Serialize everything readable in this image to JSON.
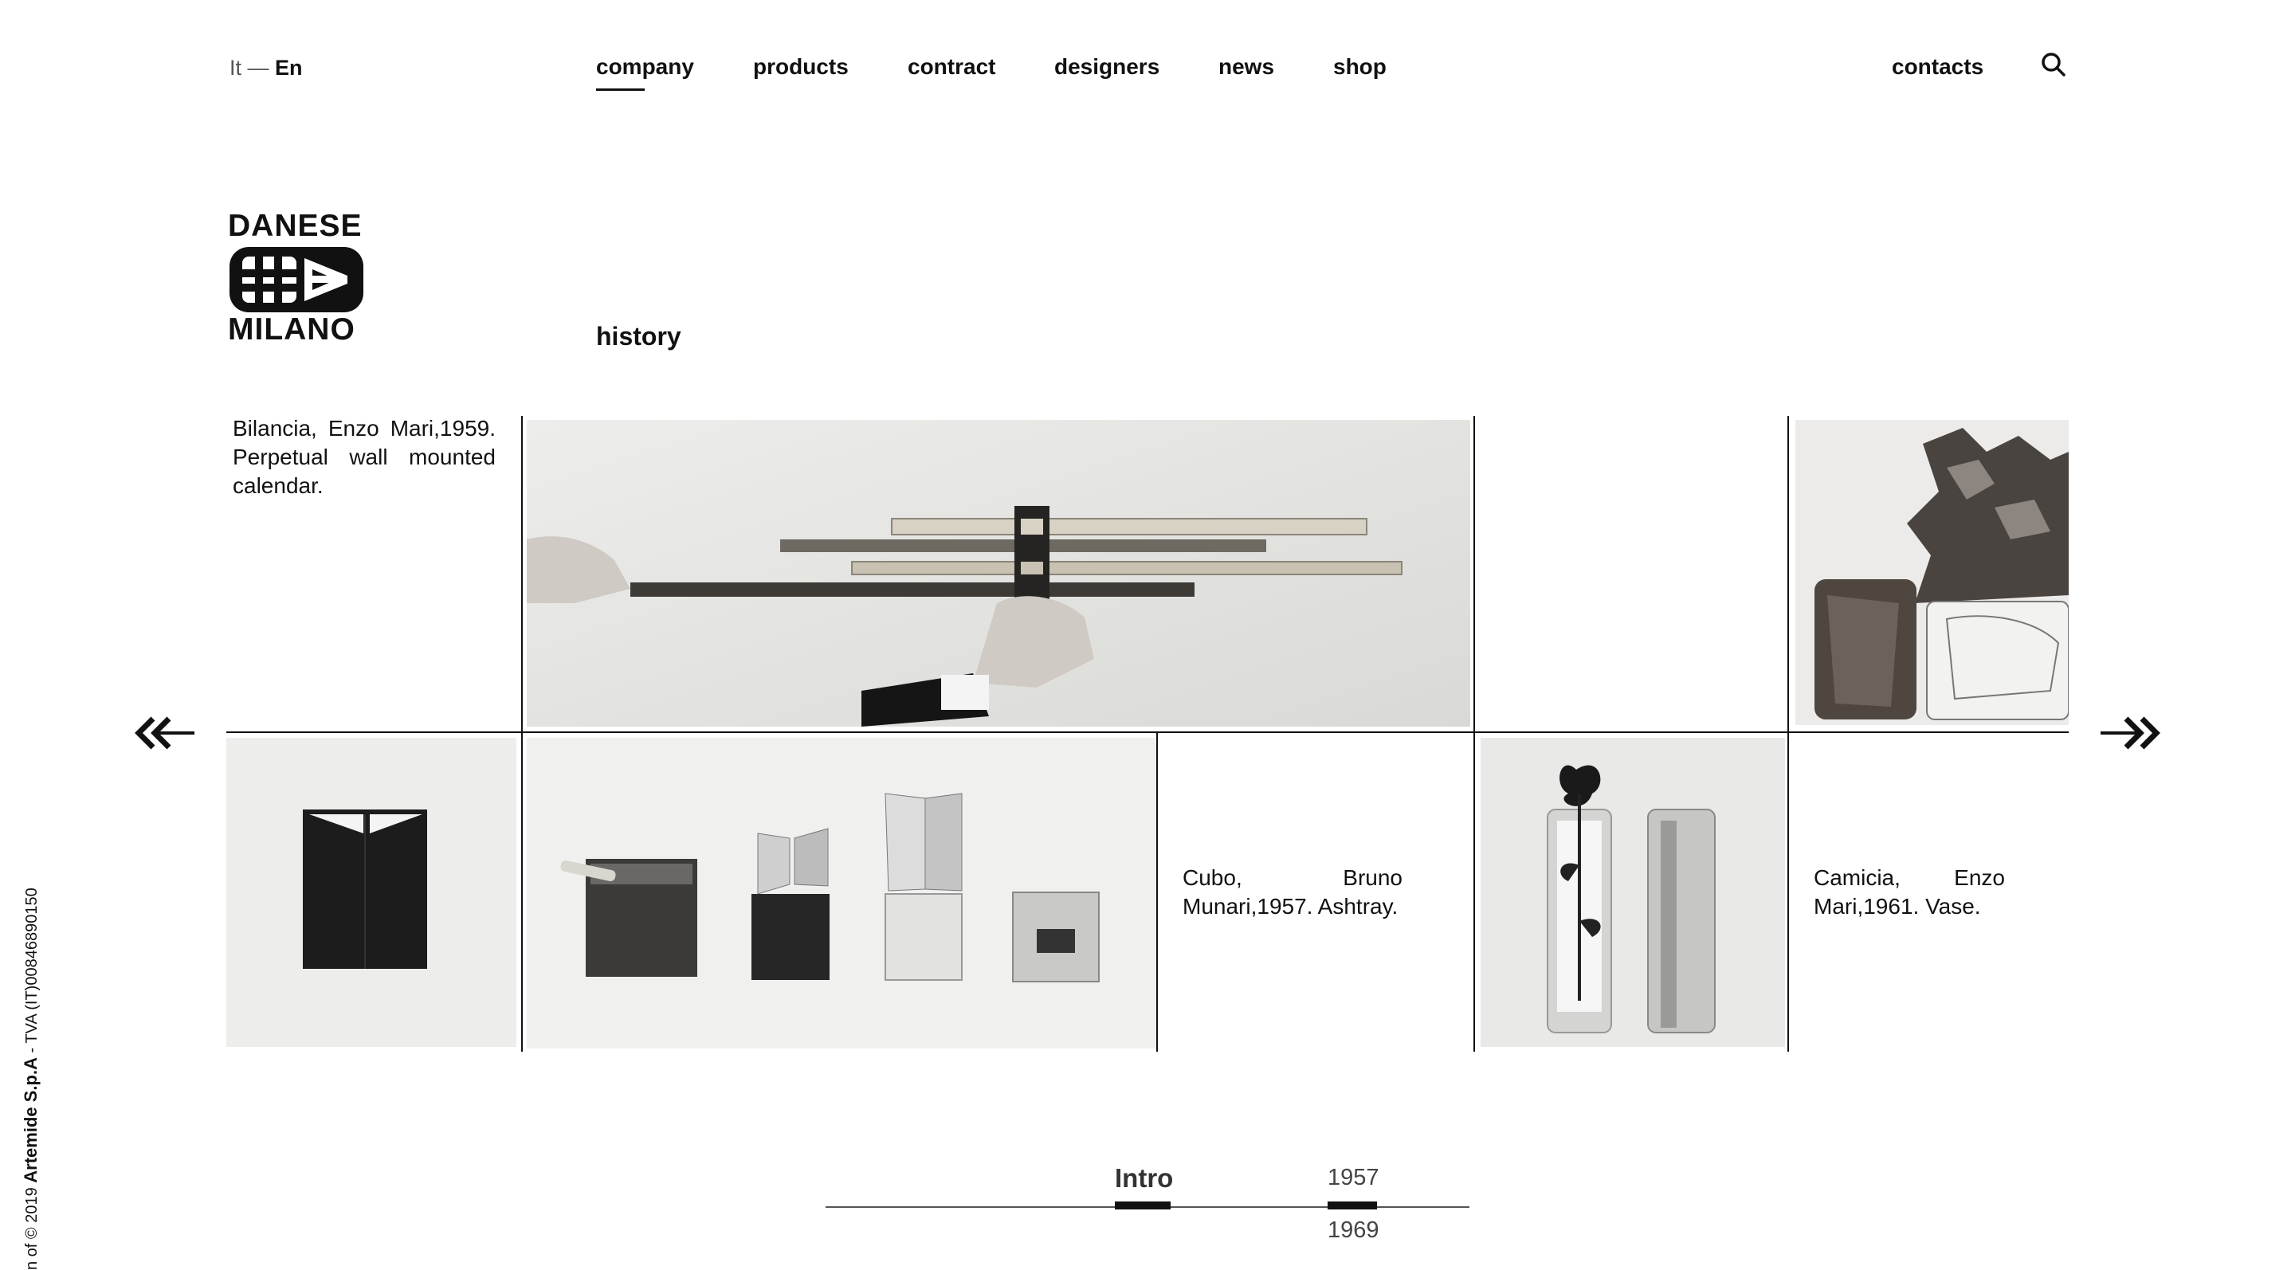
{
  "header": {
    "lang_inactive": "It",
    "lang_sep": " — ",
    "lang_active": "En",
    "nav": [
      "company",
      "products",
      "contract",
      "designers",
      "news",
      "shop"
    ],
    "active_nav": "company",
    "contacts": "contacts",
    "search_icon": "search-icon"
  },
  "logo": {
    "top": "DANESE",
    "bottom": "MILANO"
  },
  "section_title": "history",
  "gallery": {
    "captions": {
      "bilancia": "Bilancia, Enzo Mari,1959. Perpetual wall mounted calendar.",
      "cubo": "Cubo, Bruno Munari,1957. Ashtray.",
      "camicia": "Camicia, Enzo Mari,1961. Vase."
    },
    "prev_icon": "double-chevron-left-icon",
    "next_icon": "double-chevron-right-icon"
  },
  "footer": {
    "prefix": "n of © 2019 ",
    "company": "Artemide S.p.A",
    "vat": " - TVA (IT)00846890150"
  },
  "timeline": {
    "intro": "Intro",
    "years": [
      "1957",
      "1969"
    ],
    "active": "Intro"
  }
}
